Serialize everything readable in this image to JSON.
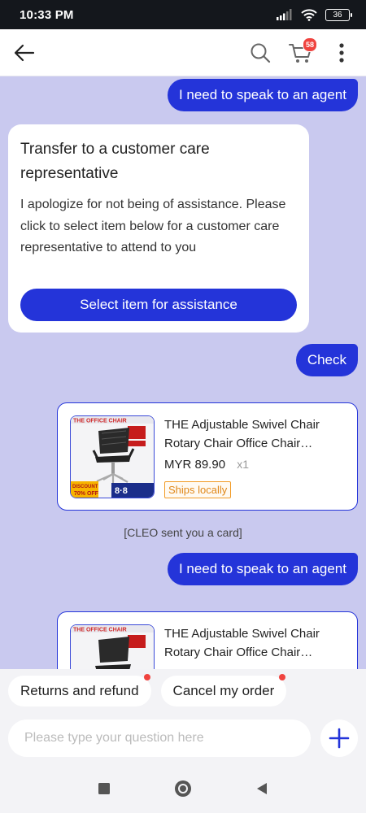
{
  "status_bar": {
    "time": "10:33 PM",
    "battery": "36",
    "icons": [
      "signal-icon",
      "wifi-icon",
      "battery-icon"
    ]
  },
  "header": {
    "icons": [
      "back-arrow-icon",
      "search-icon",
      "cart-icon",
      "more-vert-icon"
    ],
    "cart_badge": "58"
  },
  "messages": {
    "user_1": "I need to speak to an agent",
    "transfer_card": {
      "title": "Transfer to a customer care representative",
      "body": "I apologize for not being of assistance. Please click to select item below for a customer care representative to attend to you",
      "button": "Select item for assistance"
    },
    "user_2": "Check",
    "product_1": {
      "name_line1": "THE Adjustable Swivel Chair",
      "name_line2": "Rotary Chair Office Chair…",
      "price": "MYR 89.90",
      "qty": "x1",
      "badge": "Ships locally",
      "thumb_banner": "THE OFFICE CHAIR",
      "thumb_promo_1": "DISCOUNT",
      "thumb_promo_2": "70% OFF",
      "thumb_promo_3": "8·8"
    },
    "system_note": "[CLEO sent you a card]",
    "user_3": "I need to speak to an agent",
    "product_2": {
      "name_line1": "THE Adjustable Swivel Chair",
      "name_line2": "Rotary Chair Office Chair…",
      "thumb_banner": "THE OFFICE CHAIR"
    }
  },
  "quick_replies": [
    "Returns and refund",
    "Cancel my order"
  ],
  "input": {
    "placeholder": "Please type your question here",
    "value": ""
  },
  "navbar": {
    "icons": [
      "recents-square-icon",
      "home-circle-icon",
      "back-triangle-icon"
    ]
  },
  "colors": {
    "accent": "#2434d9",
    "chat_background": "#c9c9ef",
    "badge_red": "#f0433f",
    "ships_orange": "#f29b25"
  }
}
